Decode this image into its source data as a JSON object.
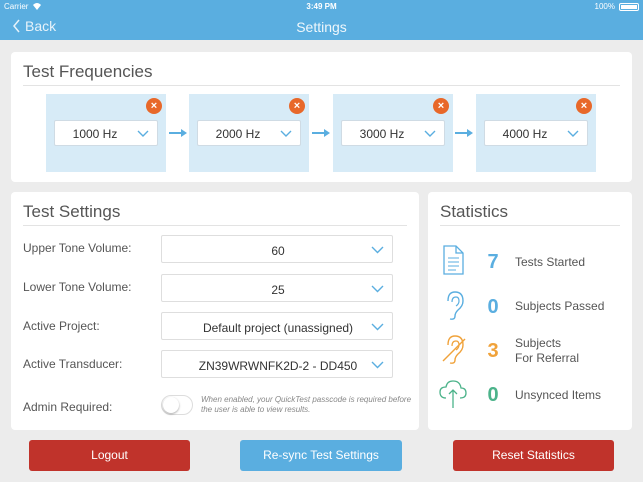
{
  "status_bar": {
    "carrier": "Carrier",
    "time": "3:49 PM",
    "battery": "100%"
  },
  "nav": {
    "back_label": "Back",
    "title": "Settings"
  },
  "frequencies": {
    "title": "Test Frequencies",
    "items": [
      {
        "value": "1000 Hz"
      },
      {
        "value": "2000 Hz"
      },
      {
        "value": "3000 Hz"
      },
      {
        "value": "4000 Hz"
      }
    ],
    "remove_glyph": "×"
  },
  "test_settings": {
    "title": "Test Settings",
    "upper_tone": {
      "label": "Upper Tone Volume:",
      "value": "60"
    },
    "lower_tone": {
      "label": "Lower Tone Volume:",
      "value": "25"
    },
    "project": {
      "label": "Active Project:",
      "value": "Default project (unassigned)"
    },
    "transducer": {
      "label": "Active Transducer:",
      "value": "ZN39WRWNFK2D-2 - DD450"
    },
    "admin": {
      "label": "Admin Required:",
      "note": "When enabled, your QuickTest passcode is required before the user is able to view results."
    }
  },
  "statistics": {
    "title": "Statistics",
    "items": [
      {
        "icon": "document-icon",
        "value": "7",
        "label": "Tests Started",
        "color": "#5aaee0"
      },
      {
        "icon": "ear-icon",
        "value": "0",
        "label": "Subjects Passed",
        "color": "#5aaee0"
      },
      {
        "icon": "ear-referral-icon",
        "value": "3",
        "label_line1": "Subjects",
        "label_line2": "For Referral",
        "color": "#f0a23a"
      },
      {
        "icon": "cloud-upload-icon",
        "value": "0",
        "label": "Unsynced Items",
        "color": "#4cb38a"
      }
    ]
  },
  "buttons": {
    "logout": "Logout",
    "resync": "Re-sync Test Settings",
    "reset": "Reset Statistics"
  },
  "colors": {
    "header": "#5aaee0",
    "danger": "#c0332b",
    "accent": "#e8682a",
    "tile": "#d7ebf7"
  }
}
